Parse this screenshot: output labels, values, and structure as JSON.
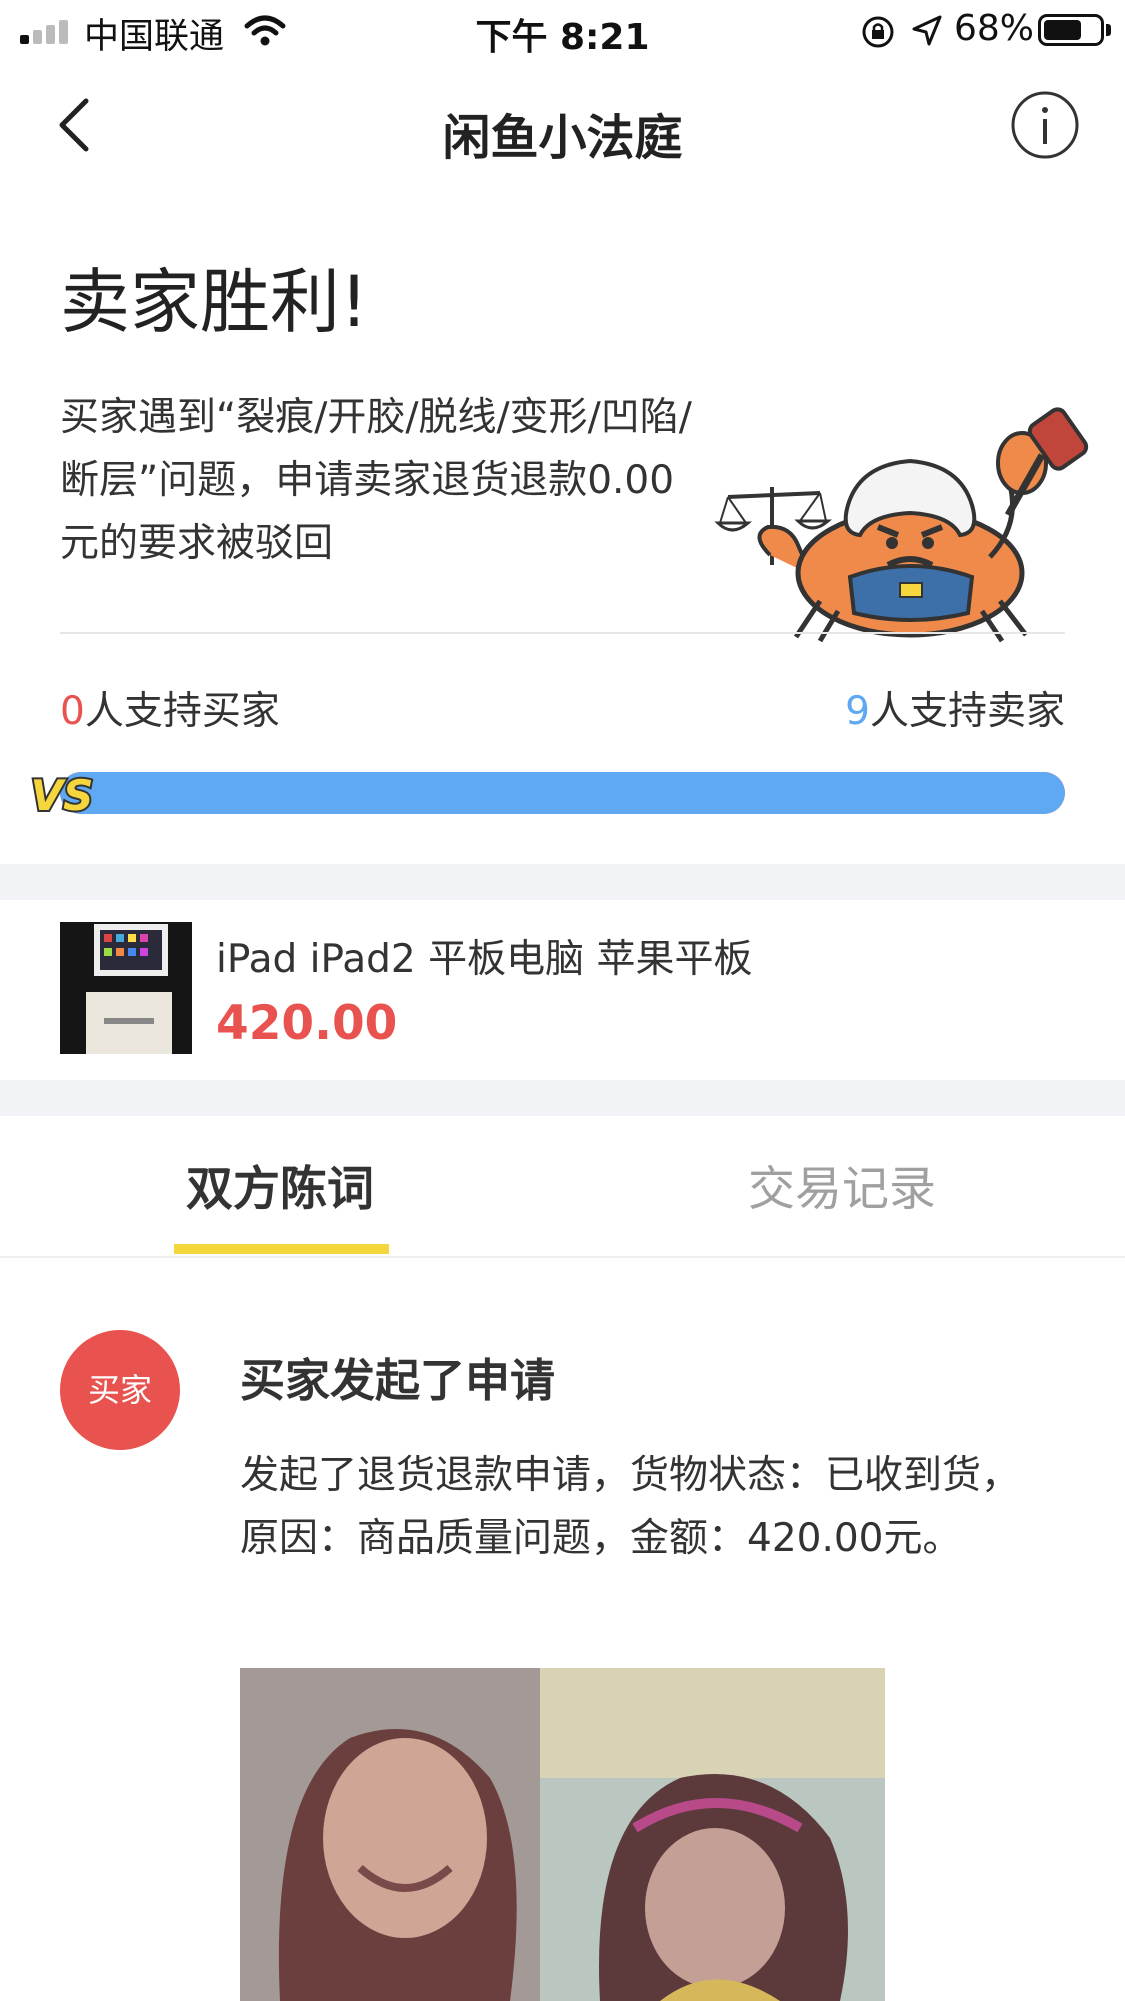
{
  "status_bar": {
    "carrier": "中国联通",
    "time": "下午 8:21",
    "battery": "68%",
    "battery_level": 0.68,
    "icons": [
      "signal-icon",
      "wifi-icon",
      "rotation-lock-icon",
      "location-arrow-icon",
      "battery-icon"
    ]
  },
  "nav": {
    "title": "闲鱼小法庭",
    "icons": [
      "back-chevron-icon",
      "info-icon"
    ]
  },
  "verdict": {
    "title": "卖家胜利!",
    "description": "买家遇到“裂痕/开胶/脱线/变形/凹陷/断层”问题，申请卖家退货退款0.00元的要求被驳回"
  },
  "votes": {
    "buyer_count": "0",
    "buyer_label": "人支持买家",
    "seller_count": "9",
    "seller_label": "人支持卖家",
    "vs_badge": "VS",
    "seller_share": 1.0
  },
  "product": {
    "title": "iPad iPad2 平板电脑 苹果平板",
    "price": "420.00"
  },
  "tabs": [
    {
      "label": "双方陈词",
      "active": true
    },
    {
      "label": "交易记录",
      "active": false
    }
  ],
  "timeline": {
    "avatar_label": "买家",
    "event_title": "买家发起了申请",
    "event_desc": "发起了退货退款申请，货物状态：已收到货，原因：商品质量问题，金额：420.00元。"
  },
  "colors": {
    "red": "#e8534f",
    "blue": "#5fa8f2",
    "yellow": "#f5d63d",
    "gap_gray": "#f2f3f6"
  }
}
